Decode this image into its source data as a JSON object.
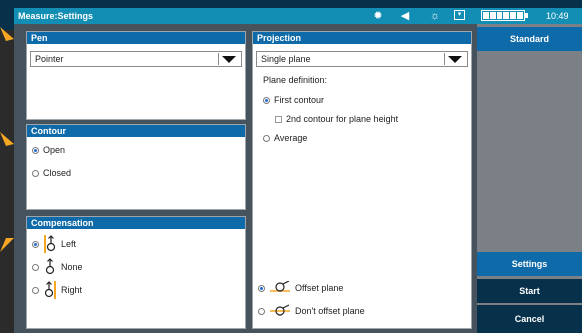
{
  "header": {
    "title": "Measure:Settings",
    "clock": "10:49"
  },
  "icons": [
    "gear-icon",
    "volume-icon",
    "brightness-icon",
    "screen-icon",
    "battery-icon"
  ],
  "pen": {
    "heading": "Pen",
    "selected": "Pointer"
  },
  "contour": {
    "heading": "Contour",
    "options": [
      "Open",
      "Closed"
    ],
    "selected": "Open"
  },
  "compensation": {
    "heading": "Compensation",
    "options": [
      "Left",
      "None",
      "Right"
    ],
    "selected": "Left"
  },
  "projection": {
    "heading": "Projection",
    "selected": "Single plane",
    "plane_definition_label": "Plane definition:",
    "first_contour": "First contour",
    "second_contour": "2nd contour for plane height",
    "average": "Average",
    "offset_plane": "Offset plane",
    "dont_offset_plane": "Don't offset plane"
  },
  "sidebar": {
    "standard": "Standard",
    "settings": "Settings",
    "start": "Start",
    "cancel": "Cancel"
  },
  "colors": {
    "accent": "#0e6aa8",
    "teal": "#128db3",
    "annotation": "#f5a623"
  }
}
